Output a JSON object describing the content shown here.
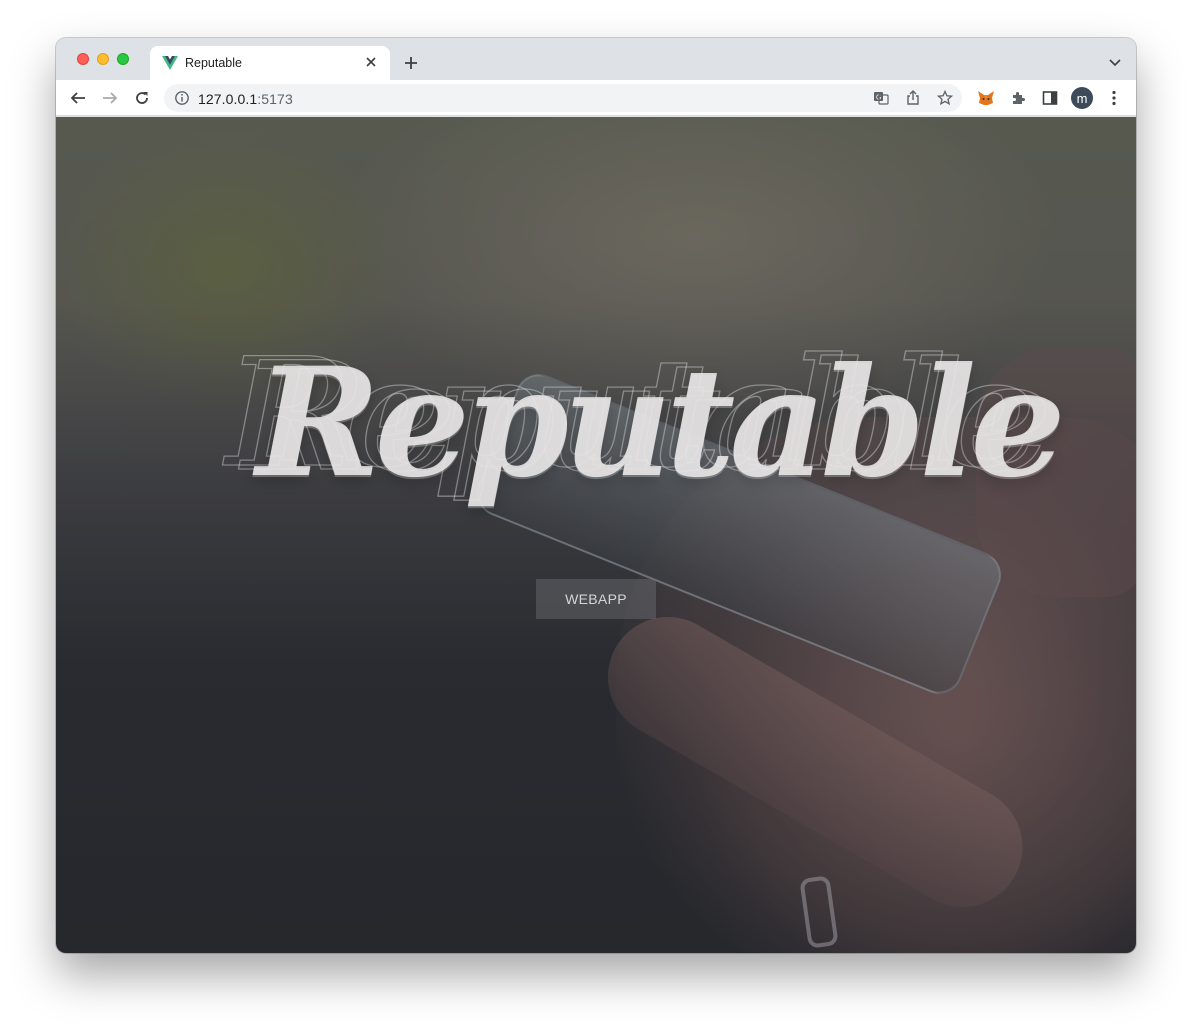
{
  "browser": {
    "tab": {
      "title": "Reputable"
    },
    "address": {
      "host": "127.0.0.1",
      "port": ":5173"
    }
  },
  "icons": {
    "favicon": "vue-logo-icon",
    "close": "close-icon",
    "new_tab": "plus-icon",
    "tab_search": "chevron-down-icon",
    "back": "arrow-left-icon",
    "forward": "arrow-right-icon",
    "reload": "reload-icon",
    "site_info": "info-icon",
    "translate": "translate-icon",
    "share": "share-icon",
    "bookmark": "star-icon",
    "metamask": "fox-icon",
    "extensions": "puzzle-icon",
    "side_panel": "side-panel-icon",
    "menu": "kebab-menu-icon"
  },
  "profile": {
    "initial": "m"
  },
  "page": {
    "logo_text": "Reputable",
    "webapp_button": "WEBAPP"
  },
  "colors": {
    "tab_strip": "#dee1e6",
    "omnibox": "#f1f3f4",
    "avatar": "#3c4a5a"
  }
}
